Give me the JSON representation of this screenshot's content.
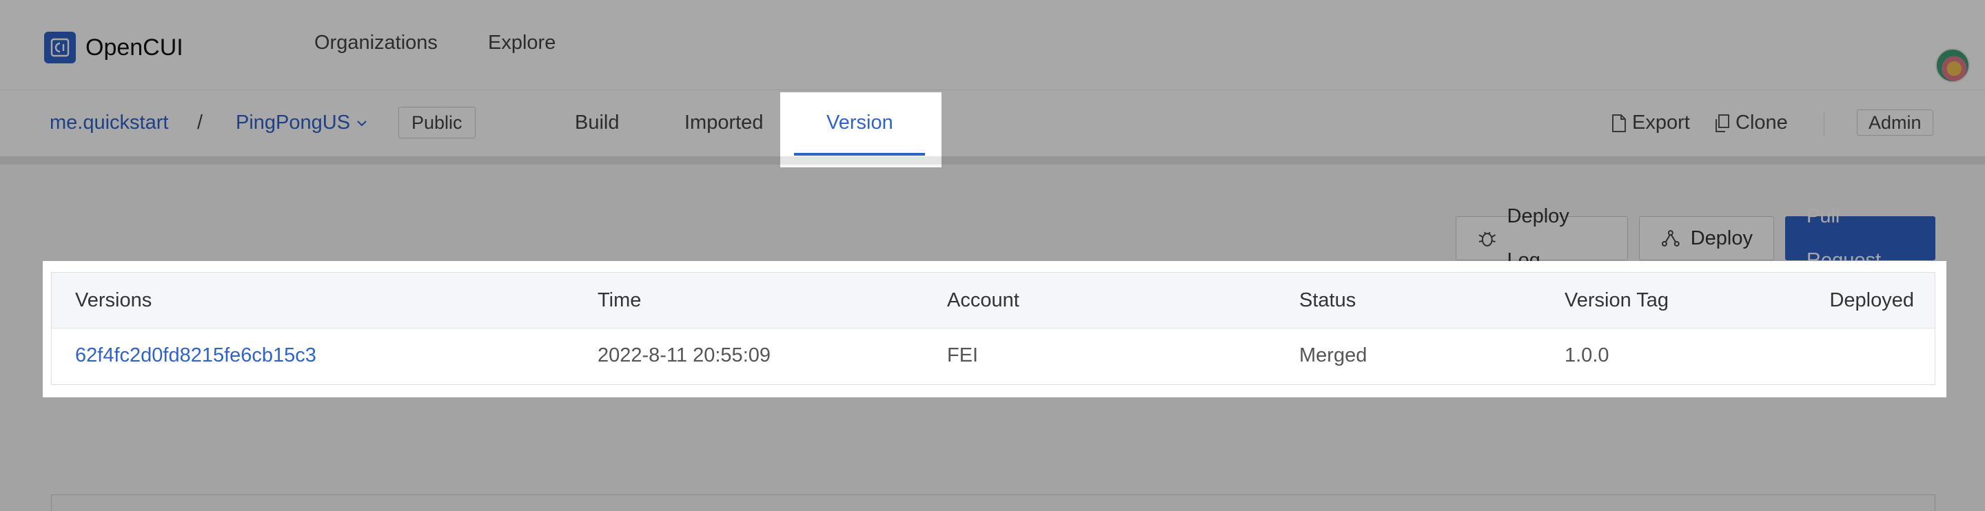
{
  "app": {
    "name": "OpenCUI"
  },
  "topnav": {
    "organizations": "Organizations",
    "explore": "Explore"
  },
  "breadcrumb": {
    "org": "me.quickstart",
    "separator": "/",
    "project": "PingPongUS",
    "visibility": "Public"
  },
  "tabs": [
    {
      "label": "Build"
    },
    {
      "label": "Imported"
    },
    {
      "label": "Version",
      "active": true
    }
  ],
  "actions": {
    "export": "Export",
    "clone": "Clone",
    "admin": "Admin"
  },
  "buttons": {
    "deploy_log": "Deploy Log",
    "deploy": "Deploy",
    "pull_request": "Pull Request"
  },
  "table": {
    "columns": [
      "Versions",
      "Time",
      "Account",
      "Status",
      "Version Tag",
      "Deployed"
    ],
    "rows": [
      {
        "version": "62f4fc2d0fd8215fe6cb15c3",
        "time": "2022-8-11 20:55:09",
        "account": "FEI",
        "status": "Merged",
        "tag": "1.0.0",
        "deployed": ""
      }
    ]
  },
  "colors": {
    "accent": "#2f63c9",
    "header_bg": "#f5f6f9"
  }
}
